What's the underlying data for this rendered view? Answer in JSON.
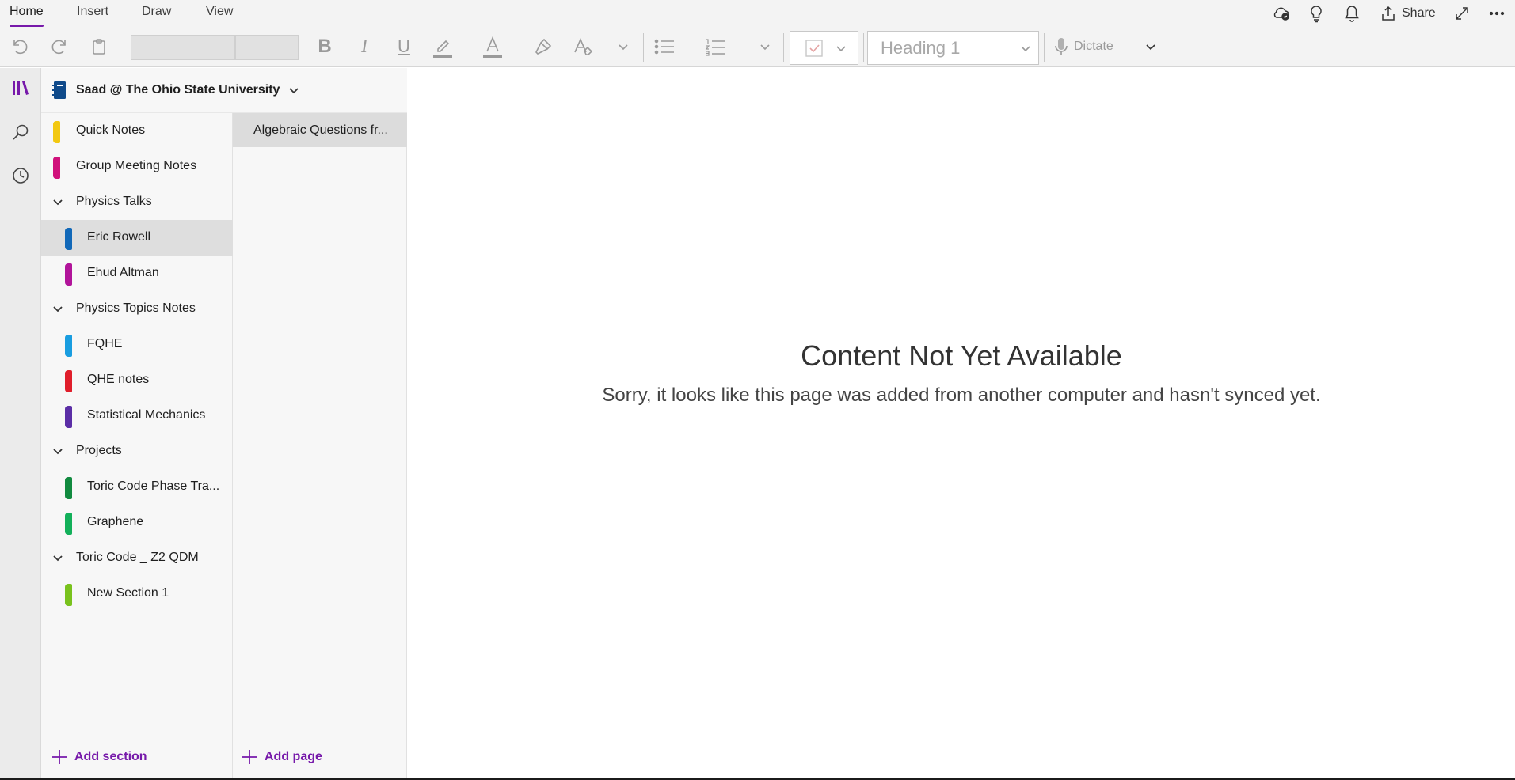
{
  "menu": {
    "tabs": [
      {
        "label": "Home",
        "active": true
      },
      {
        "label": "Insert",
        "active": false
      },
      {
        "label": "Draw",
        "active": false
      },
      {
        "label": "View",
        "active": false
      }
    ],
    "share_label": "Share",
    "icons": [
      "sync-status-icon",
      "lightbulb-icon",
      "bell-icon",
      "share-icon",
      "expand-icon",
      "more-icon"
    ]
  },
  "toolbar": {
    "font_name_value": "",
    "font_size_value": "",
    "style_value": "Heading 1",
    "dictate_label": "Dictate",
    "icons": [
      "undo-icon",
      "redo-icon",
      "clipboard-icon",
      "bold-icon",
      "italic-icon",
      "underline-icon",
      "highlight-icon",
      "font-color-icon",
      "format-painter-icon",
      "clear-format-icon",
      "bullets-icon",
      "numbering-icon",
      "todo-tag-icon",
      "microphone-icon"
    ]
  },
  "notebook": {
    "title": "Saad @ The Ohio State University"
  },
  "sections": [
    {
      "type": "section",
      "label": "Quick Notes",
      "color": "#f2c811",
      "indent": false,
      "selected": false
    },
    {
      "type": "section",
      "label": "Group Meeting Notes",
      "color": "#d0117b",
      "indent": false,
      "selected": false
    },
    {
      "type": "group",
      "label": "Physics Talks"
    },
    {
      "type": "section",
      "label": "Eric Rowell",
      "color": "#1168b8",
      "indent": true,
      "selected": true
    },
    {
      "type": "section",
      "label": "Ehud Altman",
      "color": "#b1149a",
      "indent": true,
      "selected": false
    },
    {
      "type": "group",
      "label": "Physics Topics Notes"
    },
    {
      "type": "section",
      "label": "FQHE",
      "color": "#199de0",
      "indent": true,
      "selected": false
    },
    {
      "type": "section",
      "label": "QHE notes",
      "color": "#e01e2b",
      "indent": true,
      "selected": false
    },
    {
      "type": "section",
      "label": "Statistical Mechanics",
      "color": "#5b2ea6",
      "indent": true,
      "selected": false
    },
    {
      "type": "group",
      "label": "Projects"
    },
    {
      "type": "section",
      "label": "Toric Code Phase Tra...",
      "color": "#118a3f",
      "indent": true,
      "selected": false
    },
    {
      "type": "section",
      "label": "Graphene",
      "color": "#13b05a",
      "indent": true,
      "selected": false
    },
    {
      "type": "group",
      "label": "Toric Code _ Z2 QDM"
    },
    {
      "type": "section",
      "label": "New Section 1",
      "color": "#79c21d",
      "indent": true,
      "selected": false
    }
  ],
  "pages": [
    {
      "label": "Algebraic Questions fr...",
      "selected": true
    }
  ],
  "bottom": {
    "add_section": "Add section",
    "add_page": "Add page"
  },
  "content": {
    "title": "Content Not Yet Available",
    "message": "Sorry, it looks like this page was added from another computer and hasn't synced yet."
  }
}
